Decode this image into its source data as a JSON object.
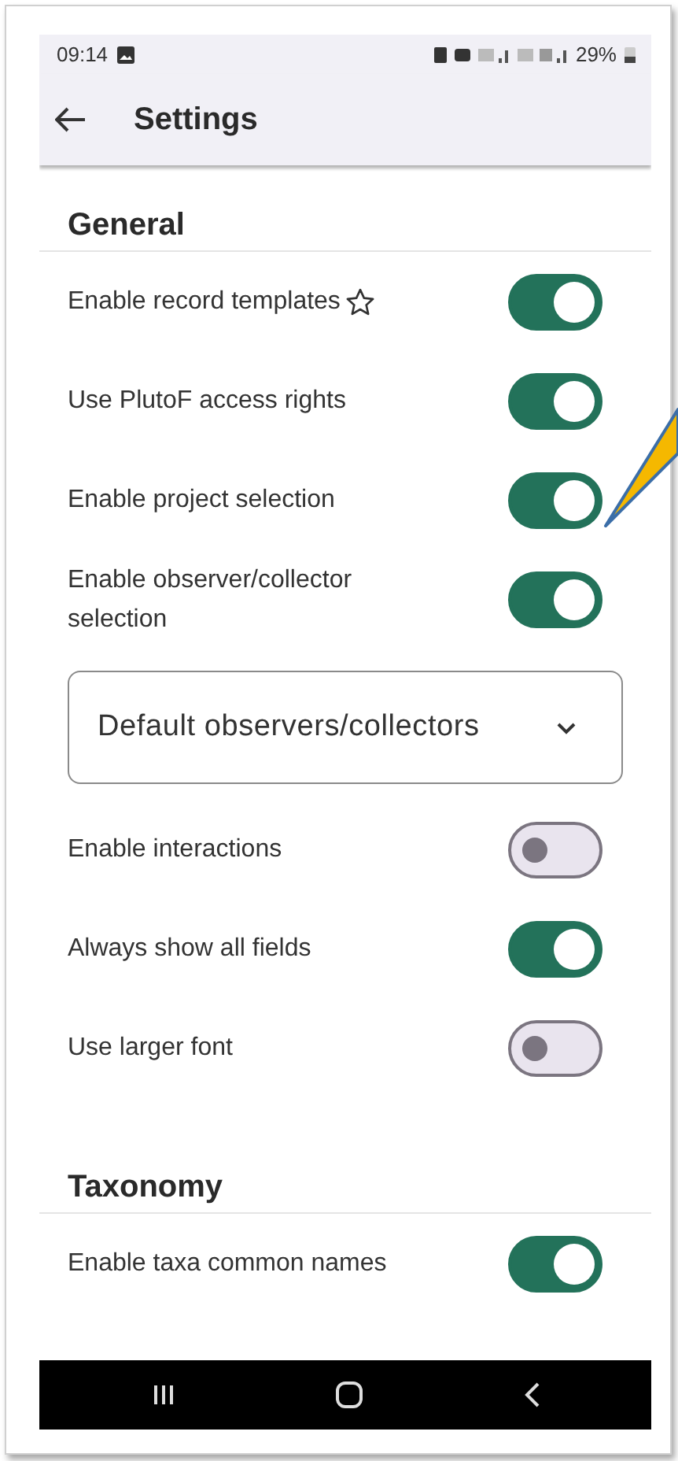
{
  "status_bar": {
    "time": "09:14",
    "battery": "29%"
  },
  "app_bar": {
    "title": "Settings"
  },
  "sections": [
    {
      "title": "General",
      "items": [
        {
          "kind": "toggle",
          "label": "Enable record templates",
          "starred": true,
          "on": true
        },
        {
          "kind": "toggle",
          "label": "Use PlutoF access rights",
          "starred": false,
          "on": true
        },
        {
          "kind": "toggle",
          "label": "Enable project selection",
          "starred": false,
          "on": true
        },
        {
          "kind": "toggle",
          "label": "Enable observer/collector selection",
          "starred": false,
          "on": true
        },
        {
          "kind": "dropdown",
          "label": "Default observers/collectors"
        },
        {
          "kind": "toggle",
          "label": "Enable interactions",
          "starred": false,
          "on": false
        },
        {
          "kind": "toggle",
          "label": "Always show all fields",
          "starred": false,
          "on": true
        },
        {
          "kind": "toggle",
          "label": "Use larger font",
          "starred": false,
          "on": false
        }
      ]
    },
    {
      "title": "Taxonomy",
      "items": [
        {
          "kind": "toggle",
          "label": "Enable taxa common names",
          "starred": false,
          "on": true
        }
      ]
    }
  ]
}
